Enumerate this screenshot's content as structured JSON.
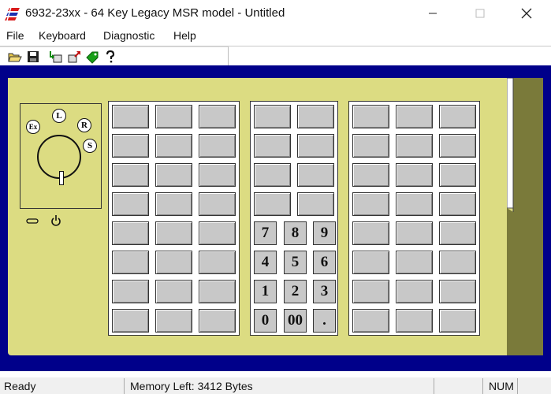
{
  "window": {
    "title": "6932-23xx - 64 Key Legacy MSR model - Untitled",
    "app_icon": "ibm-logo-icon",
    "controls": [
      "minimize-icon",
      "maximize-icon",
      "close-icon"
    ]
  },
  "menu": {
    "items": [
      {
        "label": "File"
      },
      {
        "label": "Keyboard"
      },
      {
        "label": "Diagnostic"
      },
      {
        "label": "Help"
      }
    ]
  },
  "toolbar": {
    "buttons": [
      {
        "icon": "open-folder-icon"
      },
      {
        "icon": "save-disk-icon"
      },
      {
        "icon": "download-keyboard-icon"
      },
      {
        "icon": "upload-keyboard-icon"
      },
      {
        "icon": "test-tag-icon"
      },
      {
        "icon": "help-question-icon"
      }
    ]
  },
  "keylock": {
    "positions": [
      "Ex",
      "L",
      "R",
      "S"
    ]
  },
  "numpad": {
    "rows": [
      [
        "7",
        "8",
        "9"
      ],
      [
        "4",
        "5",
        "6"
      ],
      [
        "1",
        "2",
        "3"
      ],
      [
        "0",
        "00",
        "."
      ]
    ]
  },
  "status": {
    "ready": "Ready",
    "memory": "Memory Left:  3412 Bytes",
    "num": "NUM"
  },
  "colors": {
    "workspace": "#00008a",
    "panel": "#dcdc82",
    "side_strip": "#7a7a3a",
    "key_face": "#c8c8c8"
  }
}
